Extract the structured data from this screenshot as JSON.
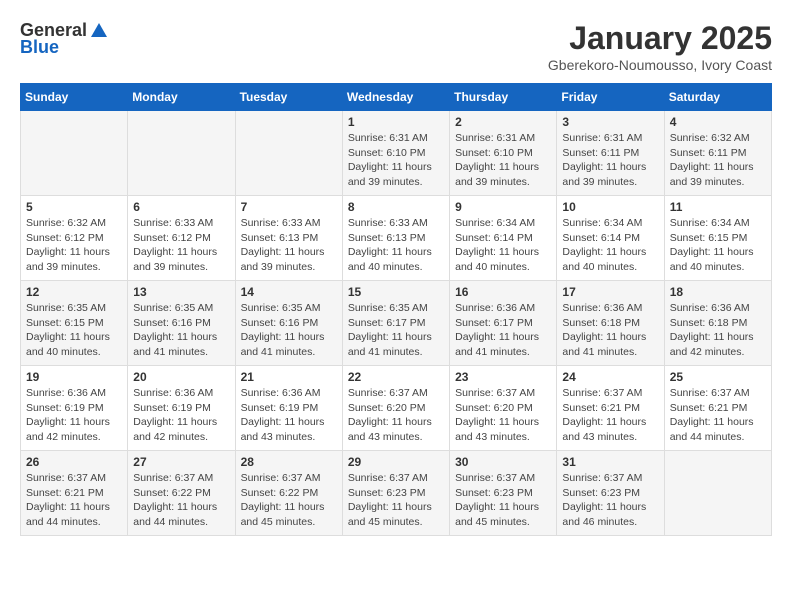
{
  "header": {
    "logo": {
      "general": "General",
      "blue": "Blue"
    },
    "title": "January 2025",
    "subtitle": "Gberekoro-Noumousso, Ivory Coast"
  },
  "days_of_week": [
    "Sunday",
    "Monday",
    "Tuesday",
    "Wednesday",
    "Thursday",
    "Friday",
    "Saturday"
  ],
  "weeks": [
    [
      {
        "day": "",
        "info": ""
      },
      {
        "day": "",
        "info": ""
      },
      {
        "day": "",
        "info": ""
      },
      {
        "day": "1",
        "info": "Sunrise: 6:31 AM\nSunset: 6:10 PM\nDaylight: 11 hours and 39 minutes."
      },
      {
        "day": "2",
        "info": "Sunrise: 6:31 AM\nSunset: 6:10 PM\nDaylight: 11 hours and 39 minutes."
      },
      {
        "day": "3",
        "info": "Sunrise: 6:31 AM\nSunset: 6:11 PM\nDaylight: 11 hours and 39 minutes."
      },
      {
        "day": "4",
        "info": "Sunrise: 6:32 AM\nSunset: 6:11 PM\nDaylight: 11 hours and 39 minutes."
      }
    ],
    [
      {
        "day": "5",
        "info": "Sunrise: 6:32 AM\nSunset: 6:12 PM\nDaylight: 11 hours and 39 minutes."
      },
      {
        "day": "6",
        "info": "Sunrise: 6:33 AM\nSunset: 6:12 PM\nDaylight: 11 hours and 39 minutes."
      },
      {
        "day": "7",
        "info": "Sunrise: 6:33 AM\nSunset: 6:13 PM\nDaylight: 11 hours and 39 minutes."
      },
      {
        "day": "8",
        "info": "Sunrise: 6:33 AM\nSunset: 6:13 PM\nDaylight: 11 hours and 40 minutes."
      },
      {
        "day": "9",
        "info": "Sunrise: 6:34 AM\nSunset: 6:14 PM\nDaylight: 11 hours and 40 minutes."
      },
      {
        "day": "10",
        "info": "Sunrise: 6:34 AM\nSunset: 6:14 PM\nDaylight: 11 hours and 40 minutes."
      },
      {
        "day": "11",
        "info": "Sunrise: 6:34 AM\nSunset: 6:15 PM\nDaylight: 11 hours and 40 minutes."
      }
    ],
    [
      {
        "day": "12",
        "info": "Sunrise: 6:35 AM\nSunset: 6:15 PM\nDaylight: 11 hours and 40 minutes."
      },
      {
        "day": "13",
        "info": "Sunrise: 6:35 AM\nSunset: 6:16 PM\nDaylight: 11 hours and 41 minutes."
      },
      {
        "day": "14",
        "info": "Sunrise: 6:35 AM\nSunset: 6:16 PM\nDaylight: 11 hours and 41 minutes."
      },
      {
        "day": "15",
        "info": "Sunrise: 6:35 AM\nSunset: 6:17 PM\nDaylight: 11 hours and 41 minutes."
      },
      {
        "day": "16",
        "info": "Sunrise: 6:36 AM\nSunset: 6:17 PM\nDaylight: 11 hours and 41 minutes."
      },
      {
        "day": "17",
        "info": "Sunrise: 6:36 AM\nSunset: 6:18 PM\nDaylight: 11 hours and 41 minutes."
      },
      {
        "day": "18",
        "info": "Sunrise: 6:36 AM\nSunset: 6:18 PM\nDaylight: 11 hours and 42 minutes."
      }
    ],
    [
      {
        "day": "19",
        "info": "Sunrise: 6:36 AM\nSunset: 6:19 PM\nDaylight: 11 hours and 42 minutes."
      },
      {
        "day": "20",
        "info": "Sunrise: 6:36 AM\nSunset: 6:19 PM\nDaylight: 11 hours and 42 minutes."
      },
      {
        "day": "21",
        "info": "Sunrise: 6:36 AM\nSunset: 6:19 PM\nDaylight: 11 hours and 43 minutes."
      },
      {
        "day": "22",
        "info": "Sunrise: 6:37 AM\nSunset: 6:20 PM\nDaylight: 11 hours and 43 minutes."
      },
      {
        "day": "23",
        "info": "Sunrise: 6:37 AM\nSunset: 6:20 PM\nDaylight: 11 hours and 43 minutes."
      },
      {
        "day": "24",
        "info": "Sunrise: 6:37 AM\nSunset: 6:21 PM\nDaylight: 11 hours and 43 minutes."
      },
      {
        "day": "25",
        "info": "Sunrise: 6:37 AM\nSunset: 6:21 PM\nDaylight: 11 hours and 44 minutes."
      }
    ],
    [
      {
        "day": "26",
        "info": "Sunrise: 6:37 AM\nSunset: 6:21 PM\nDaylight: 11 hours and 44 minutes."
      },
      {
        "day": "27",
        "info": "Sunrise: 6:37 AM\nSunset: 6:22 PM\nDaylight: 11 hours and 44 minutes."
      },
      {
        "day": "28",
        "info": "Sunrise: 6:37 AM\nSunset: 6:22 PM\nDaylight: 11 hours and 45 minutes."
      },
      {
        "day": "29",
        "info": "Sunrise: 6:37 AM\nSunset: 6:23 PM\nDaylight: 11 hours and 45 minutes."
      },
      {
        "day": "30",
        "info": "Sunrise: 6:37 AM\nSunset: 6:23 PM\nDaylight: 11 hours and 45 minutes."
      },
      {
        "day": "31",
        "info": "Sunrise: 6:37 AM\nSunset: 6:23 PM\nDaylight: 11 hours and 46 minutes."
      },
      {
        "day": "",
        "info": ""
      }
    ]
  ]
}
